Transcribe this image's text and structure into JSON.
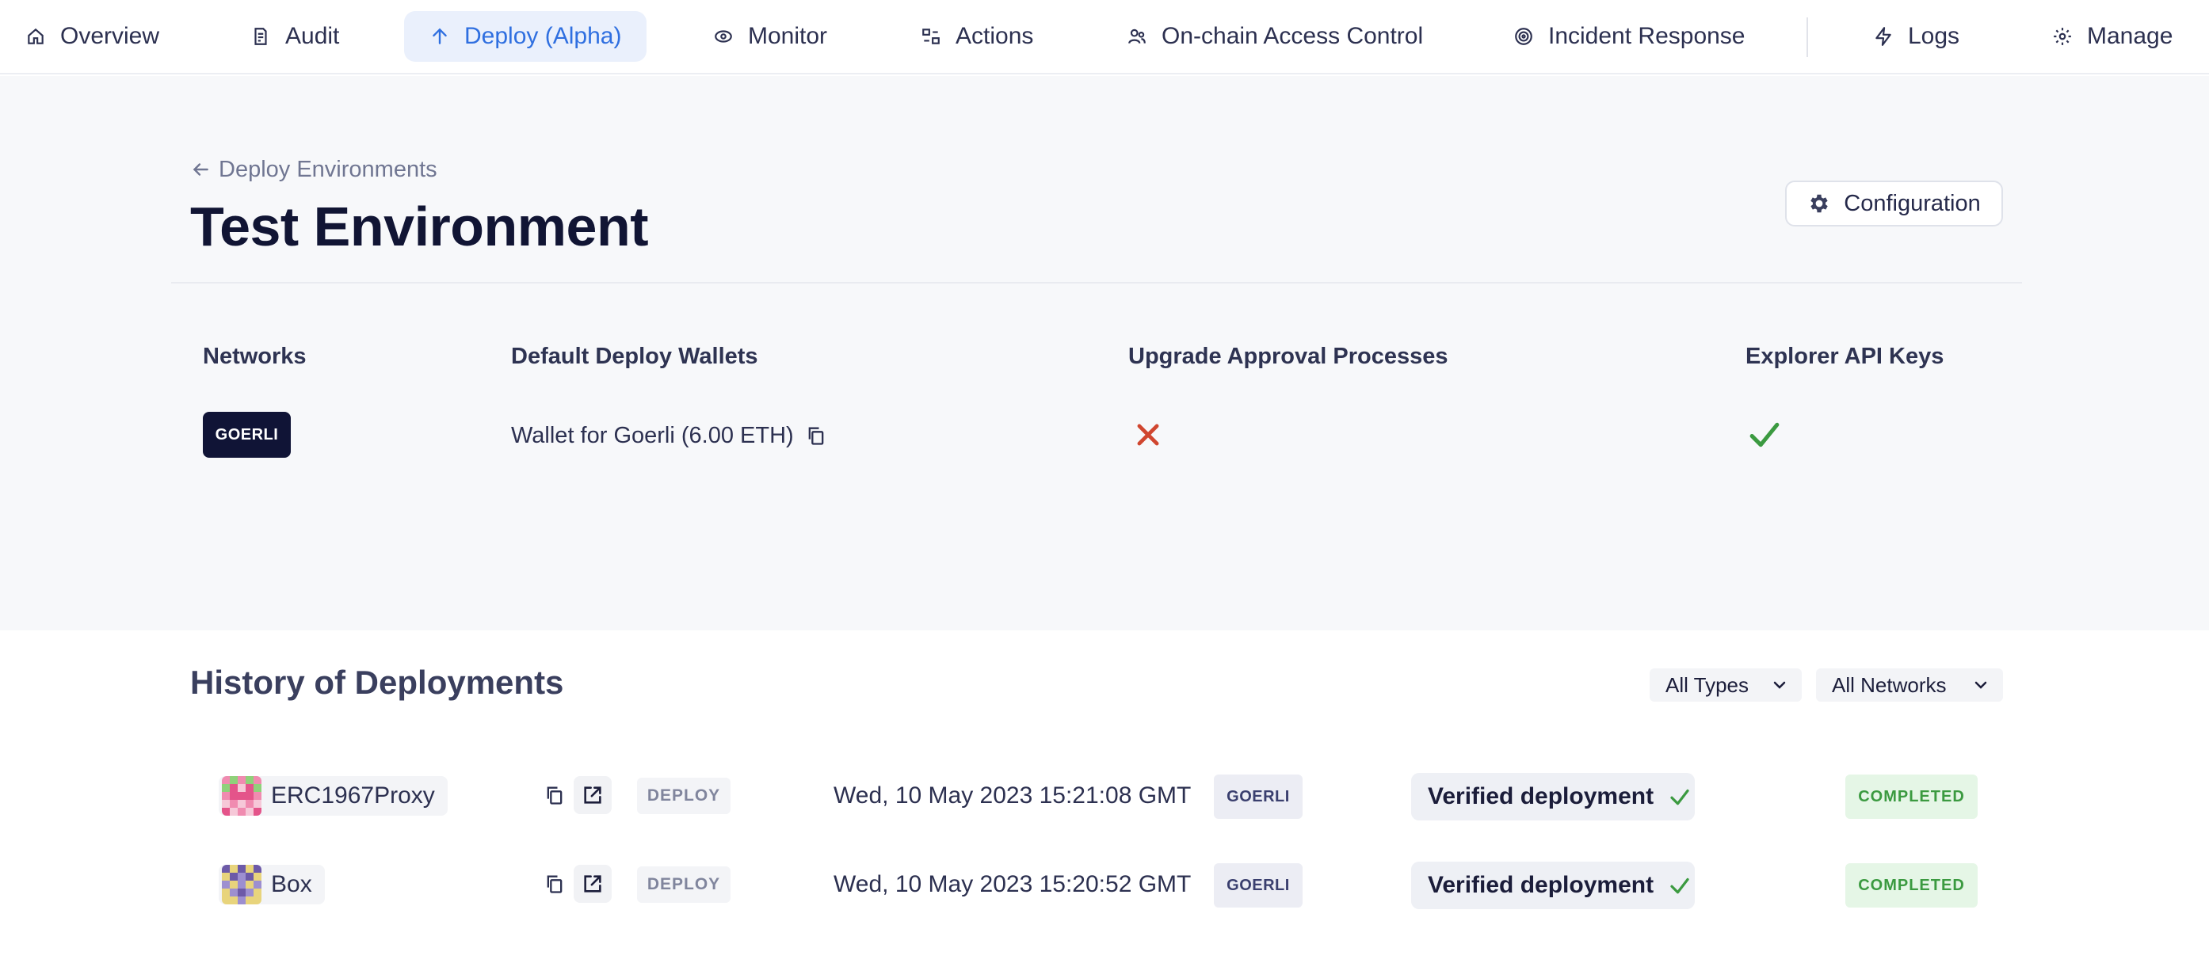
{
  "nav": {
    "items": [
      {
        "label": "Overview",
        "icon": "home-icon"
      },
      {
        "label": "Audit",
        "icon": "audit-doc-icon"
      },
      {
        "label": "Deploy (Alpha)",
        "icon": "arrow-up-icon",
        "active": true
      },
      {
        "label": "Monitor",
        "icon": "eye-icon"
      },
      {
        "label": "Actions",
        "icon": "actions-icon"
      },
      {
        "label": "On-chain Access Control",
        "icon": "users-icon"
      },
      {
        "label": "Incident Response",
        "icon": "target-icon"
      },
      {
        "label": "Logs",
        "icon": "bolt-icon"
      },
      {
        "label": "Manage",
        "icon": "gear-icon"
      }
    ]
  },
  "env": {
    "back_label": "Deploy Environments",
    "title": "Test Environment",
    "config_label": "Configuration",
    "columns": {
      "networks": "Networks",
      "wallets": "Default Deploy Wallets",
      "approval": "Upgrade Approval Processes",
      "explorer": "Explorer API Keys"
    },
    "network": "GOERLI",
    "wallet_label": "Wallet for Goerli (6.00 ETH)",
    "approval_status": "missing",
    "explorer_status": "configured"
  },
  "history": {
    "title": "History of Deployments",
    "filter_types": "All Types",
    "filter_networks": "All Networks",
    "rows": [
      {
        "contract": "ERC1967Proxy",
        "type": "DEPLOY",
        "date": "Wed, 10 May 2023 15:21:08 GMT",
        "network": "GOERLI",
        "verification": "Verified deployment",
        "status": "COMPLETED"
      },
      {
        "contract": "Box",
        "type": "DEPLOY",
        "date": "Wed, 10 May 2023 15:20:52 GMT",
        "network": "GOERLI",
        "verification": "Verified deployment",
        "status": "COMPLETED"
      }
    ]
  },
  "colors": {
    "accent": "#2f6fe0",
    "active_nav_bg": "#eaf0fc",
    "error": "#d0462f",
    "success": "#3b9a40",
    "badge_dark": "#101436"
  }
}
